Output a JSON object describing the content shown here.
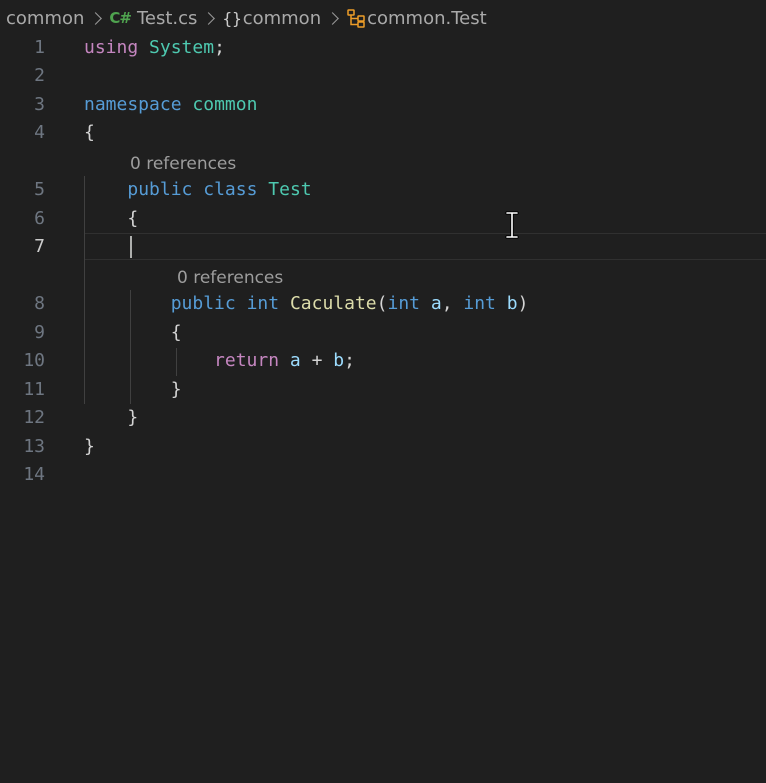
{
  "breadcrumb": {
    "folder": "common",
    "file_icon": "C#",
    "file": "Test.cs",
    "namespace_icon": "{}",
    "namespace": "common",
    "class": "common.Test"
  },
  "codelens": {
    "class_refs": "0 references",
    "method_refs": "0 references"
  },
  "lines": [
    {
      "n": "1",
      "tokens": [
        [
          "using",
          "kw-purple"
        ],
        [
          " ",
          "punct"
        ],
        [
          "System",
          "type"
        ],
        [
          ";",
          "punct"
        ]
      ]
    },
    {
      "n": "2",
      "tokens": []
    },
    {
      "n": "3",
      "tokens": [
        [
          "namespace",
          "kw-blue"
        ],
        [
          " ",
          "punct"
        ],
        [
          "common",
          "type"
        ]
      ]
    },
    {
      "n": "4",
      "tokens": [
        [
          "{",
          "punct"
        ]
      ]
    },
    {
      "n": "5",
      "tokens": [
        [
          "    ",
          "punct"
        ],
        [
          "public",
          "kw-blue"
        ],
        [
          " ",
          "punct"
        ],
        [
          "class",
          "kw-blue"
        ],
        [
          " ",
          "punct"
        ],
        [
          "Test",
          "type"
        ]
      ]
    },
    {
      "n": "6",
      "tokens": [
        [
          "    ",
          "punct"
        ],
        [
          "{",
          "punct"
        ]
      ]
    },
    {
      "n": "7",
      "tokens": []
    },
    {
      "n": "8",
      "tokens": [
        [
          "        ",
          "punct"
        ],
        [
          "public",
          "kw-blue"
        ],
        [
          " ",
          "punct"
        ],
        [
          "int",
          "kw-blue"
        ],
        [
          " ",
          "punct"
        ],
        [
          "Caculate",
          "fn"
        ],
        [
          "(",
          "punct"
        ],
        [
          "int",
          "kw-blue"
        ],
        [
          " ",
          "punct"
        ],
        [
          "a",
          "param"
        ],
        [
          ", ",
          "punct"
        ],
        [
          "int",
          "kw-blue"
        ],
        [
          " ",
          "punct"
        ],
        [
          "b",
          "param"
        ],
        [
          ")",
          "punct"
        ]
      ]
    },
    {
      "n": "9",
      "tokens": [
        [
          "        ",
          "punct"
        ],
        [
          "{",
          "punct"
        ]
      ]
    },
    {
      "n": "10",
      "tokens": [
        [
          "            ",
          "punct"
        ],
        [
          "return",
          "kw-purple"
        ],
        [
          " ",
          "punct"
        ],
        [
          "a",
          "param"
        ],
        [
          " + ",
          "punct"
        ],
        [
          "b",
          "param"
        ],
        [
          ";",
          "punct"
        ]
      ]
    },
    {
      "n": "11",
      "tokens": [
        [
          "        ",
          "punct"
        ],
        [
          "}",
          "punct"
        ]
      ]
    },
    {
      "n": "12",
      "tokens": [
        [
          "    ",
          "punct"
        ],
        [
          "}",
          "punct"
        ]
      ]
    },
    {
      "n": "13",
      "tokens": [
        [
          "}",
          "punct"
        ]
      ]
    },
    {
      "n": "14",
      "tokens": []
    }
  ],
  "active_line": "7",
  "colors": {
    "background": "#1f1f1f",
    "keyword": "#569cd6",
    "control_keyword": "#c586c0",
    "type": "#4ec9b0",
    "function": "#dcdcaa",
    "parameter": "#9cdcfe"
  }
}
